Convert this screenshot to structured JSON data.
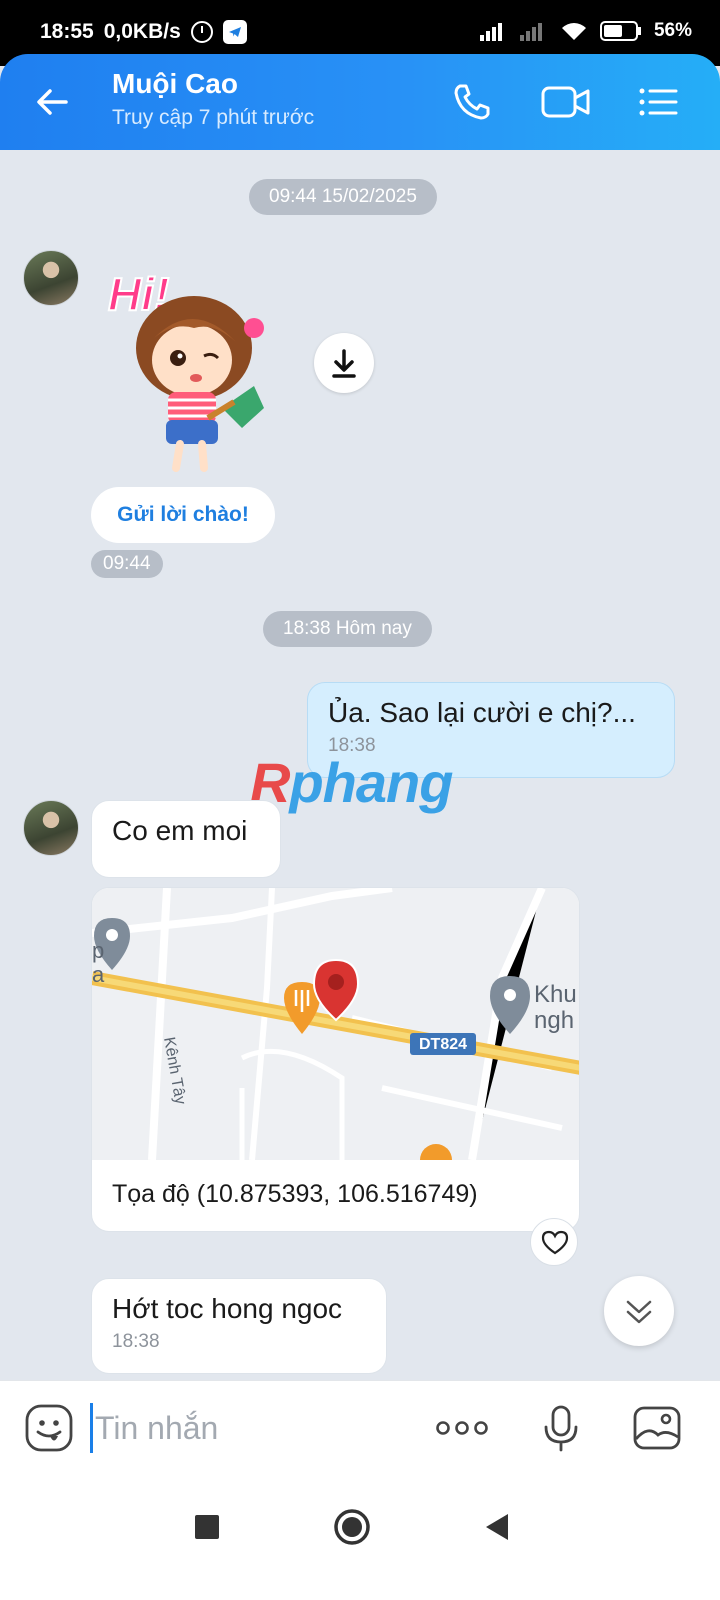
{
  "status_bar": {
    "time": "18:55",
    "net_speed": "0,0KB/s",
    "battery": "56%"
  },
  "header": {
    "contact_name": "Muội Cao",
    "last_seen": "Truy cập 7 phút trước",
    "accent_color": "#1f7ff0"
  },
  "chat": {
    "date_divider_1": "09:44 15/02/2025",
    "sticker_text": "Hi!",
    "hello_button": "Gửi lời chào!",
    "sticker_time": "09:44",
    "date_divider_2": "18:38 Hôm nay",
    "messages": [
      {
        "text": "Ủa. Sao lại cười e chị?...",
        "time": "18:38",
        "mine": true
      },
      {
        "text": "Co em moi",
        "mine": false
      },
      {
        "text": "Hớt toc hong ngoc",
        "time": "18:38",
        "mine": false
      }
    ],
    "location": {
      "caption": "Tọa độ (10.875393, 106.516749)",
      "road_label": "DT824",
      "street_label": "Kênh Tây",
      "poi_label_1": "Khu",
      "poi_label_2": "ngh",
      "poi_label_3": "p",
      "poi_label_4": "a"
    },
    "watermark": {
      "part1": "R",
      "part2": "phang"
    }
  },
  "input_bar": {
    "placeholder": "Tin nhắn"
  }
}
